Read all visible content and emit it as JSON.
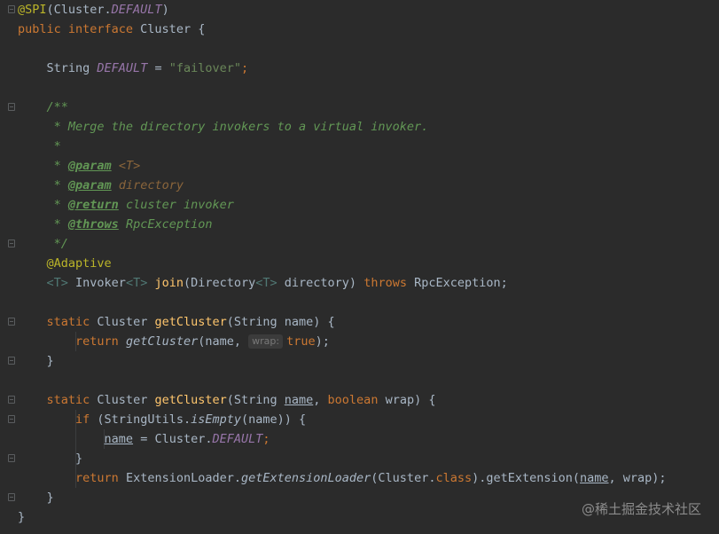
{
  "code": {
    "l1": {
      "ann": "@SPI",
      "rest": "(Cluster.",
      "const": "DEFAULT",
      "close": ")"
    },
    "l2": {
      "kw": "public interface",
      "name": " Cluster {"
    },
    "l4": {
      "type": "String ",
      "const": "DEFAULT",
      "eq": " = ",
      "str": "\"failover\"",
      "semi": ";"
    },
    "l6": {
      "doc": "/**"
    },
    "l7": {
      "doc": " * Merge the directory invokers to a virtual invoker."
    },
    "l8": {
      "doc": " *"
    },
    "l9": {
      "star": " * ",
      "tag": "@param",
      "val": " <T>"
    },
    "l10": {
      "star": " * ",
      "tag": "@param",
      "val": " directory"
    },
    "l11": {
      "star": " * ",
      "tag": "@return",
      "text": " cluster invoker"
    },
    "l12": {
      "star": " * ",
      "tag": "@throws",
      "text": " RpcException"
    },
    "l13": {
      "doc": " */"
    },
    "l14": {
      "ann": "@Adaptive"
    },
    "l15": {
      "tp1": "<T>",
      "a": " Invoker",
      "tp2": "<T>",
      "b": " ",
      "fn": "join",
      "c": "(Directory",
      "tp3": "<T>",
      "d": " directory) ",
      "kw": "throws",
      "e": " RpcException;"
    },
    "l17": {
      "kw": "static",
      "a": " Cluster ",
      "fn": "getCluster",
      "b": "(String name) {"
    },
    "l18": {
      "kw": "return",
      "a": " ",
      "call": "getCluster",
      "b": "(name, ",
      "hint": "wrap:",
      "kw2": "true",
      "c": ");"
    },
    "l19": {
      "a": "}"
    },
    "l21": {
      "kw": "static",
      "a": " Cluster ",
      "fn": "getCluster",
      "b": "(String ",
      "ul": "name",
      "c": ", ",
      "kw2": "boolean",
      "d": " wrap) {"
    },
    "l22": {
      "kw": "if",
      "a": " (StringUtils.",
      "call": "isEmpty",
      "b": "(name)) {"
    },
    "l23": {
      "ul": "name",
      "a": " = Cluster.",
      "const": "DEFAULT",
      "b": ";"
    },
    "l24": {
      "a": "}"
    },
    "l25": {
      "kw": "return",
      "a": " ExtensionLoader.",
      "call": "getExtensionLoader",
      "b": "(Cluster.",
      "kw2": "class",
      "c": ").getExtension(",
      "ul": "name",
      "d": ", wrap);"
    },
    "l26": {
      "a": "}"
    },
    "l27": {
      "a": "}"
    }
  },
  "watermark": "@稀土掘金技术社区",
  "colors": {
    "background": "#2b2b2b",
    "keyword": "#cc7832",
    "annotation": "#bbb529",
    "method": "#ffc66d",
    "string": "#6a8759",
    "constant": "#9876aa",
    "doc": "#629755",
    "text": "#a9b7c6"
  }
}
